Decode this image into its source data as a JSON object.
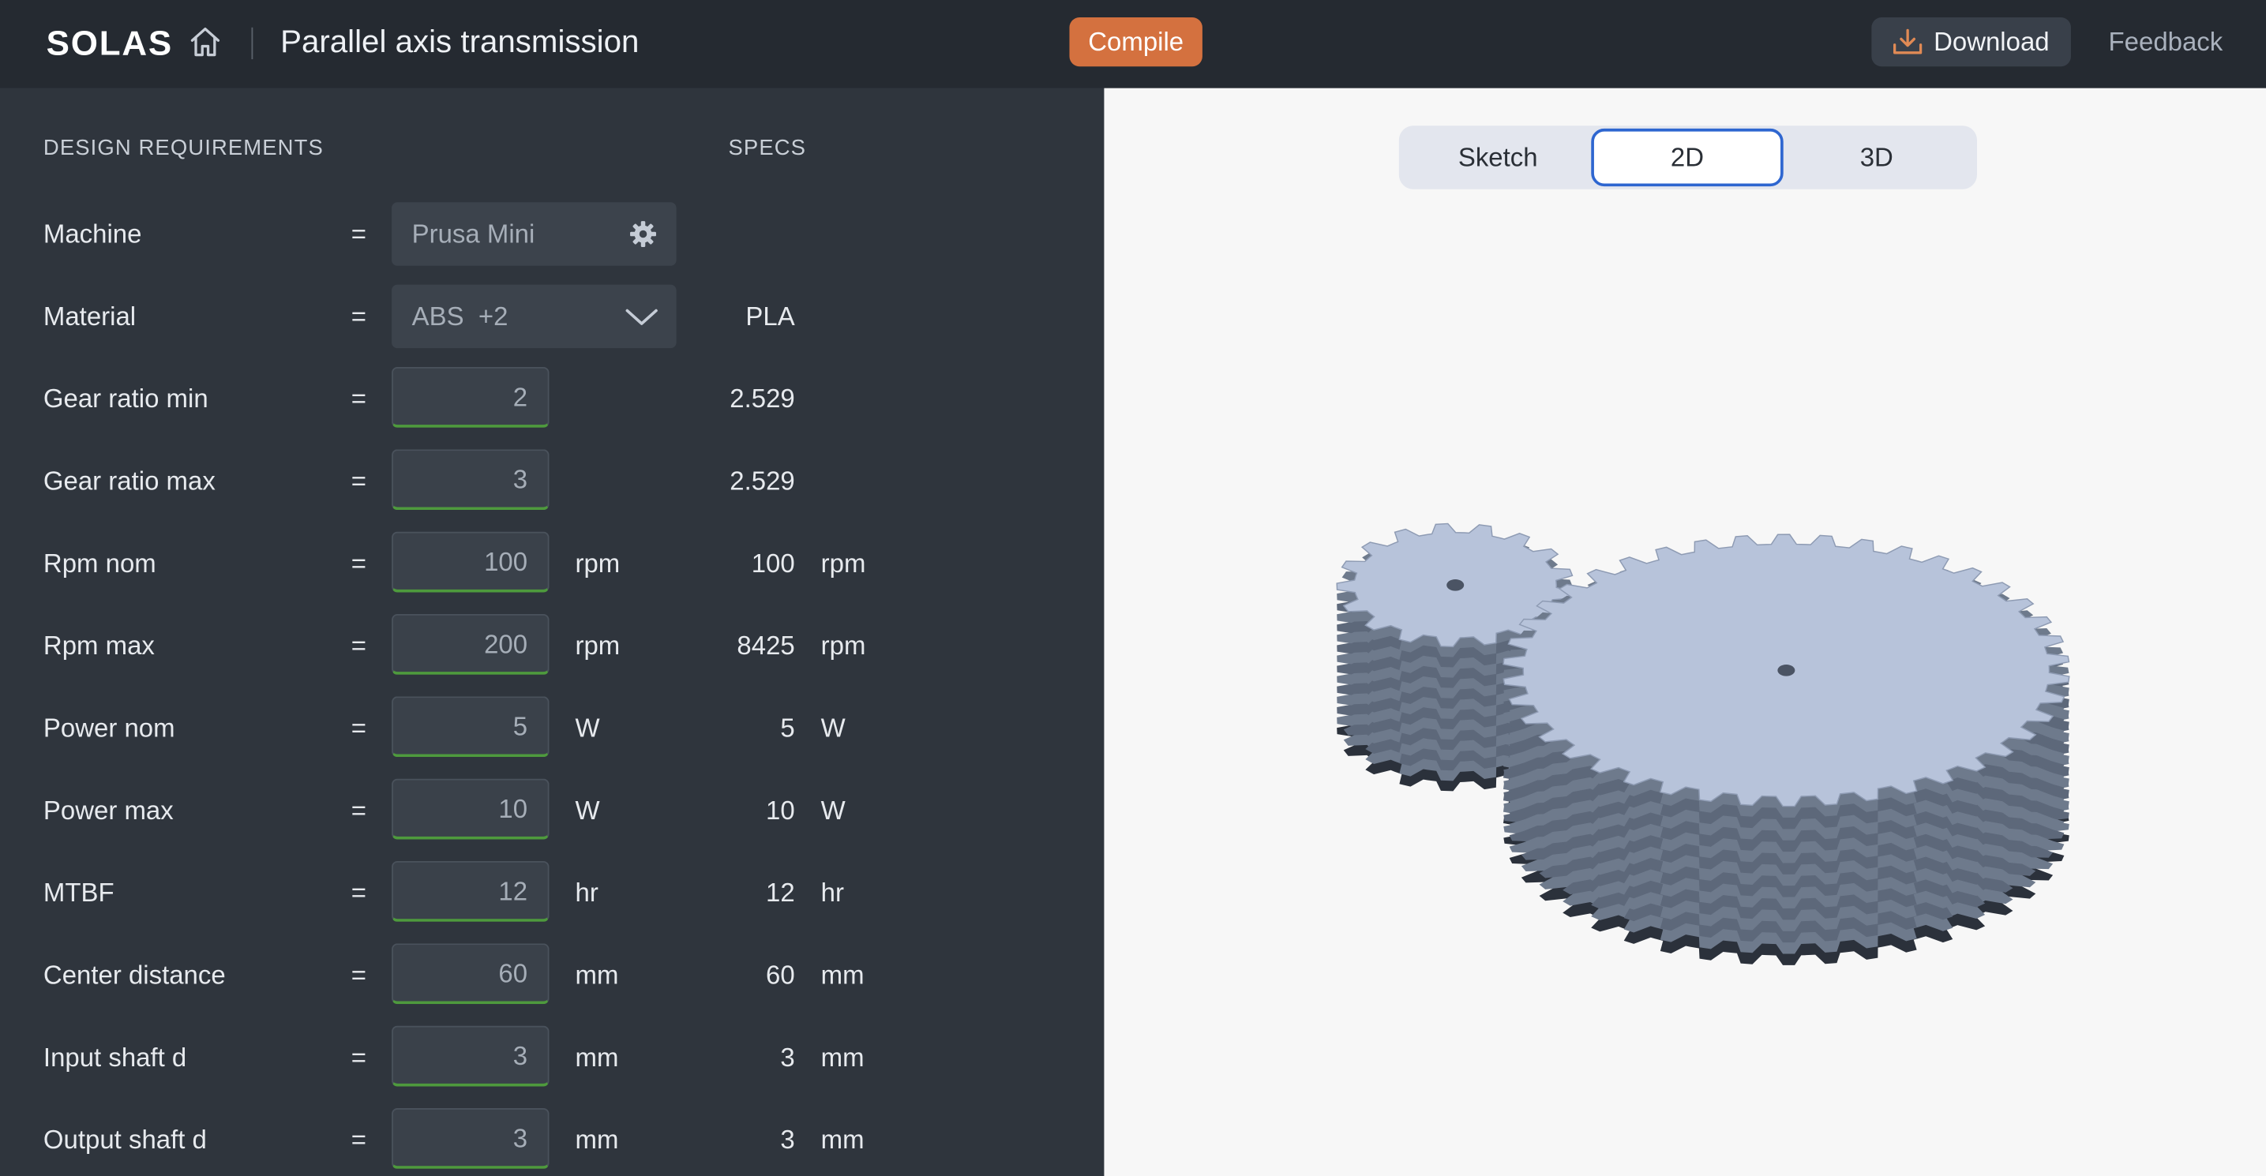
{
  "app": {
    "logo_text": "SOLAS",
    "title": "Parallel axis transmission"
  },
  "toolbar": {
    "compile_label": "Compile",
    "download_label": "Download",
    "feedback_label": "Feedback"
  },
  "panel": {
    "design_header": "DESIGN REQUIREMENTS",
    "specs_header": "SPECS",
    "eq": "=",
    "machine": {
      "label": "Machine",
      "value": "Prusa Mini"
    },
    "material": {
      "label": "Material",
      "value": "ABS  +2",
      "spec": "PLA"
    },
    "rows": [
      {
        "label": "Gear ratio min",
        "value": "2",
        "unit": "",
        "spec": "2.529",
        "spec_unit": ""
      },
      {
        "label": "Gear ratio max",
        "value": "3",
        "unit": "",
        "spec": "2.529",
        "spec_unit": ""
      },
      {
        "label": "Rpm nom",
        "value": "100",
        "unit": "rpm",
        "spec": "100",
        "spec_unit": "rpm"
      },
      {
        "label": "Rpm max",
        "value": "200",
        "unit": "rpm",
        "spec": "8425",
        "spec_unit": "rpm"
      },
      {
        "label": "Power nom",
        "value": "5",
        "unit": "W",
        "spec": "5",
        "spec_unit": "W"
      },
      {
        "label": "Power max",
        "value": "10",
        "unit": "W",
        "spec": "10",
        "spec_unit": "W"
      },
      {
        "label": "MTBF",
        "value": "12",
        "unit": "hr",
        "spec": "12",
        "spec_unit": "hr"
      },
      {
        "label": "Center distance",
        "value": "60",
        "unit": "mm",
        "spec": "60",
        "spec_unit": "mm"
      },
      {
        "label": "Input shaft d",
        "value": "3",
        "unit": "mm",
        "spec": "3",
        "spec_unit": "mm"
      },
      {
        "label": "Output shaft d",
        "value": "3",
        "unit": "mm",
        "spec": "3",
        "spec_unit": "mm"
      }
    ]
  },
  "viewer": {
    "tabs": [
      "Sketch",
      "2D",
      "3D"
    ],
    "active_tab": "2D"
  },
  "colors": {
    "topbar": "#252a31",
    "panel": "#2f353d",
    "accent_compile": "#d4713f",
    "input_valid": "#4e9a3d",
    "tab_active_border": "#2e66d0",
    "gear_top": "#b7c3da"
  },
  "icons": [
    "home-icon",
    "gear-settings-icon",
    "chevron-down-icon",
    "download-icon"
  ]
}
